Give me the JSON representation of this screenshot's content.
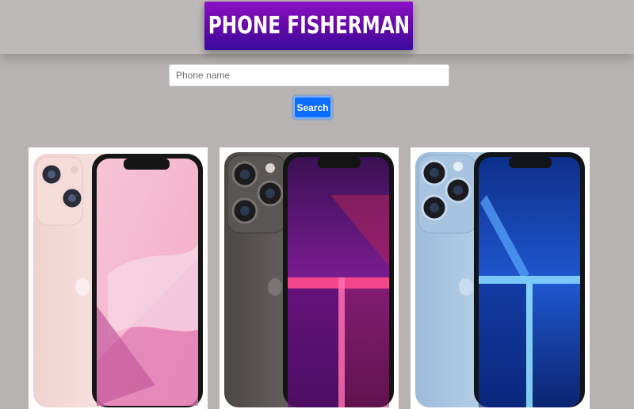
{
  "header": {
    "brand_title": "PHONE FISHERMAN"
  },
  "search": {
    "placeholder": "Phone name",
    "value": "",
    "button_label": "Search"
  },
  "products": [
    {
      "image": "pink-phone-image",
      "colors": {
        "body": "#f2d6d4",
        "screen": "#f4b7d0"
      }
    },
    {
      "image": "graphite-phone-image",
      "colors": {
        "body": "#5a5654",
        "screen": "#7a1f9a"
      }
    },
    {
      "image": "blue-phone-image",
      "colors": {
        "body": "#a9c6e2",
        "screen": "#1a4fc4"
      }
    }
  ]
}
